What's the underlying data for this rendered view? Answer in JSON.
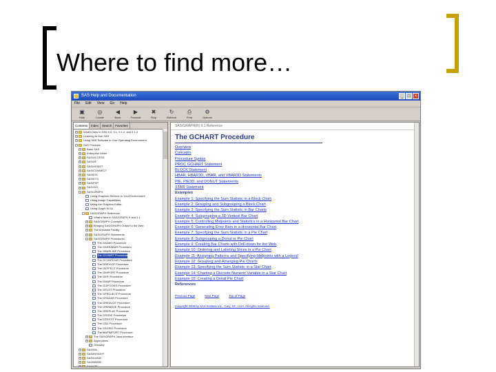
{
  "slide": {
    "title": "Where to find more…"
  },
  "window": {
    "title": "SAS Help and Documentation",
    "menu": [
      "File",
      "Edit",
      "View",
      "Go",
      "Help"
    ],
    "toolbar": [
      {
        "label": "Hide",
        "icon": "hide-icon"
      },
      {
        "label": "Locate",
        "icon": "locate-icon"
      },
      {
        "label": "Back",
        "icon": "back-icon"
      },
      {
        "label": "Forward",
        "icon": "forward-icon"
      },
      {
        "label": "Stop",
        "icon": "stop-icon"
      },
      {
        "label": "Refresh",
        "icon": "refresh-icon"
      },
      {
        "label": "Print",
        "icon": "print-icon"
      },
      {
        "label": "Options",
        "icon": "options-icon"
      }
    ],
    "tabs": [
      "Contents",
      "Index",
      "Search",
      "Favorites"
    ]
  },
  "tree": [
    {
      "label": "What's New in SAS 9.0, 9.1, 9.1.2, and 9.1.3",
      "type": "folder",
      "indent": 0,
      "exp": "+"
    },
    {
      "label": "Learning to Use SAS",
      "type": "folder",
      "indent": 0,
      "exp": "+"
    },
    {
      "label": "Using SAS Software in Your Operating Environment",
      "type": "folder",
      "indent": 0,
      "exp": "+"
    },
    {
      "label": "SAS Products",
      "type": "folder",
      "indent": 0,
      "exp": "-"
    },
    {
      "label": "Base SAS",
      "type": "folder",
      "indent": 1,
      "exp": "+"
    },
    {
      "label": "Enterprise Miner",
      "type": "folder",
      "indent": 1,
      "exp": "+"
    },
    {
      "label": "SAS/ACCESS",
      "type": "folder",
      "indent": 1,
      "exp": "+"
    },
    {
      "label": "SAS/AF",
      "type": "folder",
      "indent": 1,
      "exp": "+"
    },
    {
      "label": "SAS/ASSIST",
      "type": "folder",
      "indent": 1,
      "exp": "+"
    },
    {
      "label": "SAS/CONNECT",
      "type": "folder",
      "indent": 1,
      "exp": "+"
    },
    {
      "label": "SAS/EIS",
      "type": "folder",
      "indent": 1,
      "exp": "+"
    },
    {
      "label": "SAS/ETS",
      "type": "folder",
      "indent": 1,
      "exp": "+"
    },
    {
      "label": "SAS/FSP",
      "type": "folder",
      "indent": 1,
      "exp": "+"
    },
    {
      "label": "SAS/GIS",
      "type": "folder",
      "indent": 1,
      "exp": "+"
    },
    {
      "label": "SAS/GRAPH",
      "type": "folder",
      "indent": 1,
      "exp": "-"
    },
    {
      "label": "Using Graphics Devices in Your Environment",
      "type": "page",
      "indent": 2,
      "exp": ""
    },
    {
      "label": "Using Image Capabilities",
      "type": "page",
      "indent": 2,
      "exp": ""
    },
    {
      "label": "Using the Graphics Editor",
      "type": "page",
      "indent": 2,
      "exp": ""
    },
    {
      "label": "Using Graph-N-Go",
      "type": "page",
      "indent": 2,
      "exp": ""
    },
    {
      "label": "SAS/GRAPH Reference",
      "type": "folder",
      "indent": 2,
      "exp": "-"
    },
    {
      "label": "What's New in SAS/GRAPH 9 and 9.1",
      "type": "page",
      "indent": 3,
      "exp": ""
    },
    {
      "label": "SAS/GRAPH Concepts",
      "type": "folder",
      "indent": 3,
      "exp": "+"
    },
    {
      "label": "Bringing SAS/GRAPH Output to the Web",
      "type": "folder",
      "indent": 3,
      "exp": "+"
    },
    {
      "label": "The Annotate Facility",
      "type": "folder",
      "indent": 3,
      "exp": "+"
    },
    {
      "label": "SAS/GRAPH Statements",
      "type": "folder",
      "indent": 3,
      "exp": "+"
    },
    {
      "label": "SAS/GRAPH Procedures",
      "type": "folder",
      "indent": 3,
      "exp": "-"
    },
    {
      "label": "The GANNO Procedure",
      "type": "page",
      "indent": 4,
      "exp": ""
    },
    {
      "label": "The GAREABAR Procedure",
      "type": "page",
      "indent": 4,
      "exp": ""
    },
    {
      "label": "The GBARLINE Procedure",
      "type": "page",
      "indent": 4,
      "exp": ""
    },
    {
      "label": "The GCHART Procedure",
      "type": "page",
      "indent": 4,
      "exp": "",
      "selected": true
    },
    {
      "label": "The GCONTOUR Procedure",
      "type": "page",
      "indent": 4,
      "exp": ""
    },
    {
      "label": "The GDEVICE Procedure",
      "type": "page",
      "indent": 4,
      "exp": ""
    },
    {
      "label": "The GEFFECT Procedure",
      "type": "page",
      "indent": 4,
      "exp": ""
    },
    {
      "label": "The GIMPORT Procedure",
      "type": "page",
      "indent": 4,
      "exp": ""
    },
    {
      "label": "The GKPI Procedure",
      "type": "page",
      "indent": 4,
      "exp": ""
    },
    {
      "label": "The GMAP Procedure",
      "type": "page",
      "indent": 4,
      "exp": ""
    },
    {
      "label": "The GOPTIONS Procedure",
      "type": "page",
      "indent": 4,
      "exp": ""
    },
    {
      "label": "The GPLOT Procedure",
      "type": "page",
      "indent": 4,
      "exp": ""
    },
    {
      "label": "The GPROJECT Procedure",
      "type": "page",
      "indent": 4,
      "exp": ""
    },
    {
      "label": "The GRADAR Procedure",
      "type": "page",
      "indent": 4,
      "exp": ""
    },
    {
      "label": "The GREDUCE Procedure",
      "type": "page",
      "indent": 4,
      "exp": ""
    },
    {
      "label": "The GREMOVE Procedure",
      "type": "page",
      "indent": 4,
      "exp": ""
    },
    {
      "label": "The GREPLAY Procedure",
      "type": "page",
      "indent": 4,
      "exp": ""
    },
    {
      "label": "The GSLIDE Procedure",
      "type": "page",
      "indent": 4,
      "exp": ""
    },
    {
      "label": "The GTESTIT Procedure",
      "type": "page",
      "indent": 4,
      "exp": ""
    },
    {
      "label": "The G3D Procedure",
      "type": "page",
      "indent": 4,
      "exp": ""
    },
    {
      "label": "The G3GRID Procedure",
      "type": "page",
      "indent": 4,
      "exp": ""
    },
    {
      "label": "The MAPIMPORT Procedure",
      "type": "page",
      "indent": 4,
      "exp": ""
    },
    {
      "label": "The SAS/GRAPH Java Interface",
      "type": "folder",
      "indent": 3,
      "exp": "+"
    },
    {
      "label": "Appendixes",
      "type": "folder",
      "indent": 3,
      "exp": "+"
    },
    {
      "label": "Glossary",
      "type": "page",
      "indent": 3,
      "exp": ""
    },
    {
      "label": "SAS/IML",
      "type": "folder",
      "indent": 1,
      "exp": "+"
    },
    {
      "label": "SAS/INSIGHT",
      "type": "folder",
      "indent": 1,
      "exp": "+"
    },
    {
      "label": "SAS/IntrNet",
      "type": "folder",
      "indent": 1,
      "exp": "+"
    },
    {
      "label": "SAS/MDDB",
      "type": "folder",
      "indent": 1,
      "exp": "+"
    },
    {
      "label": "SAS/OR",
      "type": "folder",
      "indent": 1,
      "exp": "+"
    },
    {
      "label": "SAS/QC",
      "type": "folder",
      "indent": 1,
      "exp": "+"
    },
    {
      "label": "SAS Help Procedural Reporting",
      "type": "folder",
      "indent": 0,
      "exp": "+"
    },
    {
      "label": "SAS/IML",
      "type": "folder",
      "indent": 0,
      "exp": "+"
    },
    {
      "label": "SAS/INSIGHT",
      "type": "folder",
      "indent": 0,
      "exp": "+"
    }
  ],
  "content": {
    "header": "SAS/GRAPH(R) 9.1 Reference",
    "title": "The GCHART Procedure",
    "sections": [
      {
        "label": "Overview",
        "kind": "sub"
      },
      {
        "label": "Concepts",
        "kind": "sub"
      },
      {
        "label": "Procedure Syntax",
        "kind": "sub"
      },
      {
        "label": "PROC GCHART Statement",
        "kind": "ex"
      },
      {
        "label": "BLOCK Statement",
        "kind": "ex"
      },
      {
        "label": "HBAR, HBAR3D, VBAR, and VBAR3D Statements",
        "kind": "ex"
      },
      {
        "label": "PIE, PIE3D, and DONUT Statements",
        "kind": "ex"
      },
      {
        "label": "STAR Statement",
        "kind": "ex"
      },
      {
        "label": "Examples",
        "kind": "bold"
      },
      {
        "label": "Example 1: Specifying the Sum Statistic in a Block Chart",
        "kind": "ex"
      },
      {
        "label": "Example 2: Grouping and Subgrouping a Block Chart",
        "kind": "ex"
      },
      {
        "label": "Example 3: Specifying the Sum Statistic in Bar Charts",
        "kind": "ex"
      },
      {
        "label": "Example 4: Subgrouping a 3D Vertical Bar Chart",
        "kind": "ex"
      },
      {
        "label": "Example 5: Controlling Midpoints and Statistics in a Horizontal Bar Chart",
        "kind": "ex"
      },
      {
        "label": "Example 6: Generating Error Bars in a Horizontal Bar Chart",
        "kind": "ex"
      },
      {
        "label": "Example 7: Specifying the Sum Statistic in a Pie Chart",
        "kind": "ex"
      },
      {
        "label": "Example 8: Subgrouping a Donut or Pie Chart",
        "kind": "ex"
      },
      {
        "label": "Example 9: Creating Bar Charts with Drill-down for the Web",
        "kind": "ex"
      },
      {
        "label": "Example 10: Ordering and Labeling Slices in a Pie Chart",
        "kind": "ex"
      },
      {
        "label": "Example 11: Assigning Patterns and Specifying Midpoints with a Legend",
        "kind": "ex"
      },
      {
        "label": "Example 12: Grouping and Arranging Pie Charts",
        "kind": "ex"
      },
      {
        "label": "Example 13: Specifying the Sum Statistic in a Star Chart",
        "kind": "ex"
      },
      {
        "label": "Example 14: Charting a Discrete Numeric Variable in a Star Chart",
        "kind": "ex"
      },
      {
        "label": "Example 15: Creating a Detail Pie Chart",
        "kind": "ex"
      },
      {
        "label": "References",
        "kind": "bold"
      }
    ],
    "nav": [
      "Previous Page",
      "Next Page",
      "Top of Page"
    ],
    "copyright": "Copyright 2005 by SAS Institute Inc., Cary, NC, USA. All rights reserved."
  }
}
